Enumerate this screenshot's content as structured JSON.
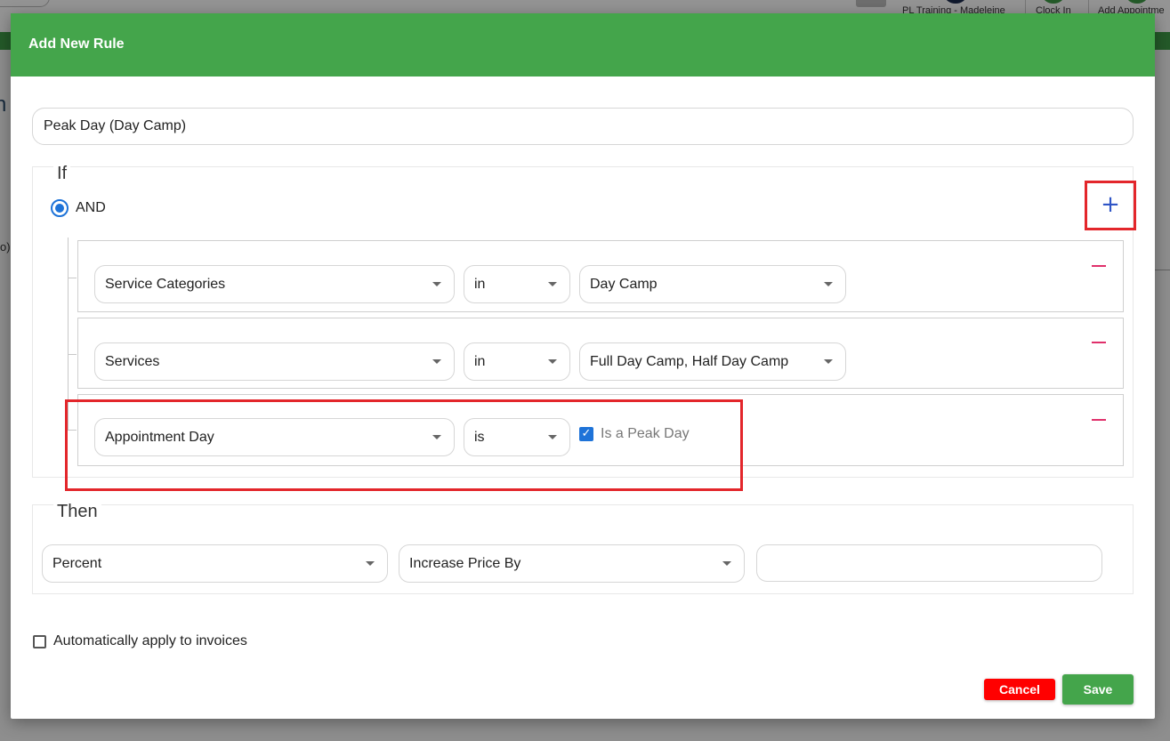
{
  "background": {
    "top_labels": [
      "PL Training - Madeleine",
      "Clock In",
      "Add Appointme"
    ],
    "fragment_left": "n",
    "fragment_small": "o)"
  },
  "modal": {
    "title": "Add New Rule",
    "rule_name": "Peak Day (Day Camp)",
    "if_section": {
      "legend": "If",
      "operator": "AND",
      "add_icon": "plus-icon",
      "add_symbol": "+",
      "conditions": [
        {
          "field": "Service Categories",
          "operator": "in",
          "value": "Day Camp"
        },
        {
          "field": "Services",
          "operator": "in",
          "value": "Full Day Camp, Half Day Camp"
        },
        {
          "field": "Appointment Day",
          "operator": "is",
          "checkbox_checked": true,
          "checkbox_label": "Is a Peak Day"
        }
      ]
    },
    "then_section": {
      "legend": "Then",
      "type": "Percent",
      "action": "Increase Price By",
      "amount": ""
    },
    "auto_apply": {
      "label": "Automatically apply to invoices",
      "checked": false
    },
    "buttons": {
      "cancel": "Cancel",
      "save": "Save"
    },
    "colors": {
      "header": "#44a54b",
      "save": "#44a54b",
      "cancel": "#ff0000",
      "radio": "#1e73d8",
      "plus": "#2f55c6",
      "minus": "#e0306b",
      "highlight": "#e3262b"
    }
  }
}
